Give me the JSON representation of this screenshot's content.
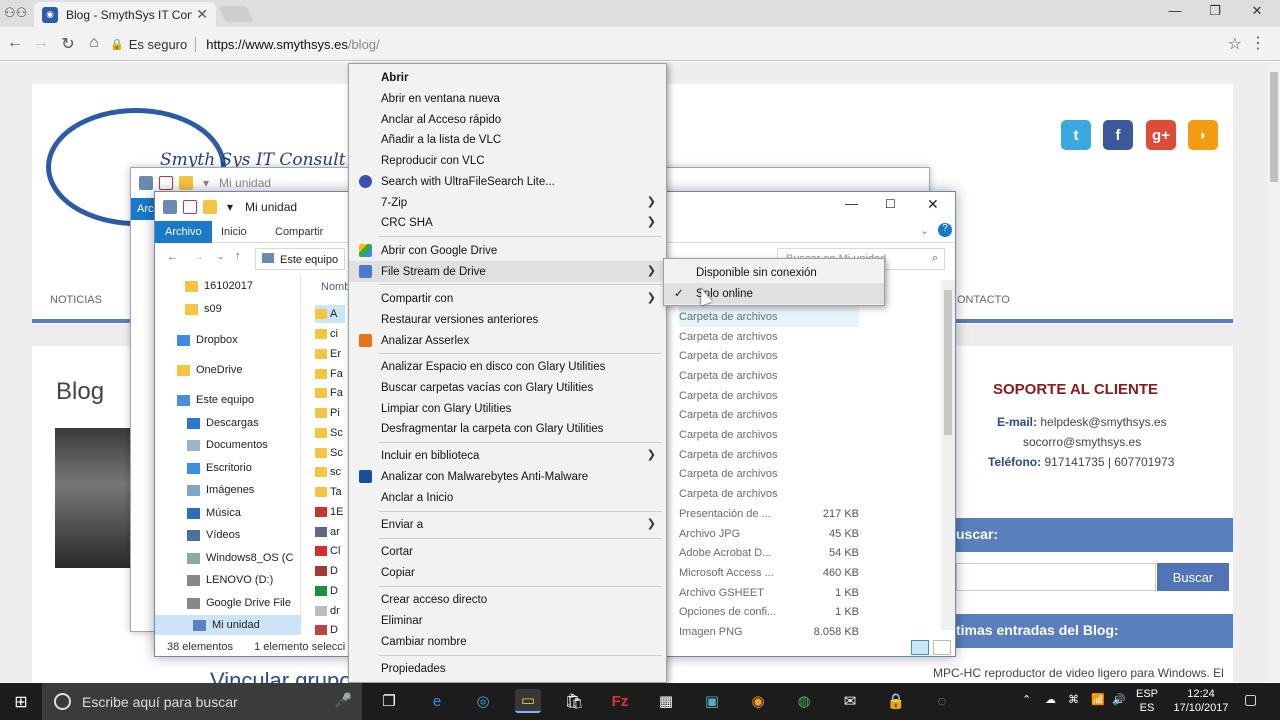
{
  "browser": {
    "tab_title": "Blog - SmythSys IT Consu",
    "secure_label": "Es seguro",
    "url_host": "https://www.smythsys.es",
    "url_path": "/blog/"
  },
  "website": {
    "logo_text": "Smyth Sys IT Consult",
    "nav": [
      "NOTICIAS",
      "ONTACTO"
    ],
    "blog_heading": "Blog",
    "post_title": "Vincular grupos ... ros grupos",
    "support_title": "SOPORTE AL CLIENTE",
    "email_label": "E-mail:",
    "email1": "helpdesk@smythsys.es",
    "email2": "socorro@smythsys.es",
    "phone_label": "Teléfono:",
    "phone": "917141735 | 607701973",
    "search_heading": "uscar:",
    "search_button": "Buscar",
    "latest_heading": "timas entradas del Blog:",
    "latest_item": "MPC-HC reproductor de video ligero para Windows. El"
  },
  "explorer_back": {
    "title": "Mi unidad",
    "ribbon_tab": "Arc"
  },
  "explorer": {
    "title": "Mi unidad",
    "ribbon_tabs": [
      "Archivo",
      "Inicio",
      "Compartir"
    ],
    "address": "Este equipo",
    "search_placeholder": "Buscar en Mi unidad",
    "column_name": "Nomb",
    "nav_items": [
      "16102017",
      "s09",
      "Dropbox",
      "OneDrive",
      "Este equipo",
      "Descargas",
      "Documentos",
      "Escritorio",
      "Imágenes",
      "Música",
      "Vídeos",
      "Windows8_OS (C",
      "LENOVO (D:)",
      "Google Drive File",
      "Mi unidad"
    ],
    "file_stubs": [
      "A",
      "ci",
      "Er",
      "Fa",
      "Fa",
      "Pi",
      "Sc",
      "Sc",
      "sc",
      "Ta",
      "1E",
      "ar",
      "Cl",
      "D",
      "D",
      "dr",
      "D"
    ],
    "types": [
      {
        "type": "Carpeta de archivos",
        "size": ""
      },
      {
        "type": "Carpeta de archivos",
        "size": ""
      },
      {
        "type": "Carpeta de archivos",
        "size": ""
      },
      {
        "type": "Carpeta de archivos",
        "size": ""
      },
      {
        "type": "Carpeta de archivos",
        "size": ""
      },
      {
        "type": "Carpeta de archivos",
        "size": ""
      },
      {
        "type": "Carpeta de archivos",
        "size": ""
      },
      {
        "type": "Carpeta de archivos",
        "size": ""
      },
      {
        "type": "Carpeta de archivos",
        "size": ""
      },
      {
        "type": "Carpeta de archivos",
        "size": ""
      },
      {
        "type": "Presentación de ...",
        "size": "217 KB"
      },
      {
        "type": "Archivo JPG",
        "size": "45 KB"
      },
      {
        "type": "Adobe Acrobat D...",
        "size": "54 KB"
      },
      {
        "type": "Microsoft Access ...",
        "size": "460 KB"
      },
      {
        "type": "Archivo GSHEET",
        "size": "1 KB"
      },
      {
        "type": "Opciones de confi...",
        "size": "1 KB"
      },
      {
        "type": "Imagen PNG",
        "size": "8.058 KB"
      }
    ],
    "status_count": "38 elementos",
    "status_selected": "1 elemento selecci"
  },
  "context_menu": {
    "items": [
      "Abrir",
      "Abrir en ventana nueva",
      "Anclar al Acceso rápido",
      "Añadir a la lista de VLC",
      "Reproducir con VLC",
      "Search with UltraFileSearch Lite...",
      "7-Zip",
      "CRC SHA",
      "Abrir con Google Drive",
      "File Stream de Drive",
      "Compartir con",
      "Restaurar versiones anteriores",
      "Analizar Asserlex",
      "Analizar Espacio en disco con Glary Utilities",
      "Buscar carpetas vacías con Glary Utilities",
      "Limpiar con Glary Utilities",
      "Desfragmentar la carpeta con Glary Utilities",
      "Incluir en biblioteca",
      "Analizar con Malwarebytes Anti-Malware",
      "Anclar a Inicio",
      "Enviar a",
      "Cortar",
      "Copiar",
      "Crear acceso directo",
      "Eliminar",
      "Cambiar nombre",
      "Propiedades"
    ]
  },
  "submenu": {
    "items": [
      "Disponible sin conexión",
      "Solo online"
    ]
  },
  "taskbar": {
    "search_placeholder": "Escribe aquí para buscar",
    "lang1": "ESP",
    "lang2": "ES",
    "time": "12:24",
    "date": "17/10/2017"
  }
}
